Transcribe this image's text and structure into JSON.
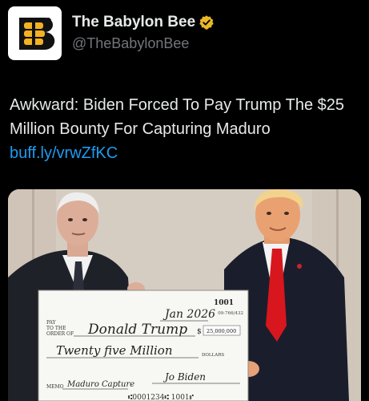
{
  "account": {
    "display_name": "The Babylon Bee",
    "handle": "@TheBabylonBee",
    "verified": true,
    "avatar_icon": "babylon-bee-logo-icon",
    "verified_icon": "gold-verified-badge-icon"
  },
  "tweet": {
    "text": "Awkward: Biden Forced To Pay Trump The $25 Million Bounty For Capturing Maduro",
    "link": "buff.ly/vrwZfKC"
  },
  "check": {
    "number": "1001",
    "routing": "09-766/432",
    "date": "Jan 2026",
    "pay_label_1": "PAY",
    "pay_label_2": "TO THE",
    "pay_label_3": "ORDER OF",
    "payee": "Donald Trump",
    "amount_symbol": "$",
    "amount": "25,000,000",
    "written_amount": "Twenty five Million",
    "dollars_label": "DOLLARS",
    "memo_label": "MEMO",
    "memo": "Maduro Capture",
    "signature": "Jo Biden",
    "micr": "⑆0001234⑆ 1001⑈"
  },
  "colors": {
    "background": "#000000",
    "text": "#e7e9ea",
    "secondary": "#71767b",
    "link": "#1d9bf0",
    "verified": "#e8b829",
    "bee_yellow": "#f4b223"
  }
}
